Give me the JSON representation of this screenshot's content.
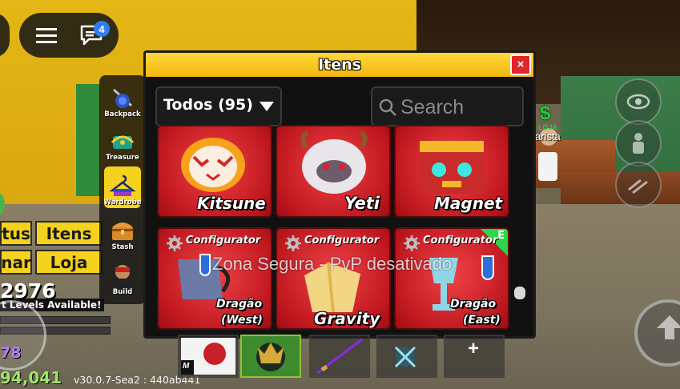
{
  "topbar": {
    "menu_icon": "hamburger-menu-icon",
    "chat_icon": "chat-bubble-icon",
    "chat_badge": "4"
  },
  "left_menu": {
    "row1": [
      "tus",
      "Itens"
    ],
    "row2": [
      "nar",
      "Loja"
    ]
  },
  "stats": {
    "beli_value": "2976",
    "levels_text": "t Levels Available!",
    "purple_value": "78",
    "green_value": "94,041"
  },
  "version": "v30.0.7-Sea2 : 440ab441",
  "npc": {
    "dollar": "$",
    "sign": "LOJA",
    "name": "arista"
  },
  "sidebar": {
    "items": [
      {
        "label": "Backpack",
        "icon": "backpack-icon",
        "active": false
      },
      {
        "label": "Treasure",
        "icon": "treasure-icon",
        "active": false
      },
      {
        "label": "Wardrobe",
        "icon": "wardrobe-hanger-icon",
        "active": true
      },
      {
        "label": "Stash",
        "icon": "stash-chest-icon",
        "active": false
      },
      {
        "label": "Build",
        "icon": "build-character-icon",
        "active": false
      }
    ]
  },
  "window": {
    "title": "Itens",
    "close_label": "×",
    "filter_label": "Todos (95)",
    "search_placeholder": "Search"
  },
  "items": [
    {
      "name": "Kitsune",
      "configurator": "Configurator"
    },
    {
      "name": "Yeti",
      "configurator": "Configurator"
    },
    {
      "name": "Magnet",
      "configurator": "Configurator"
    },
    {
      "name_line1": "Dragão",
      "name_line2": "(West)",
      "configurator": "Configurator"
    },
    {
      "name": "Gravity",
      "configurator": "Configurator"
    },
    {
      "name_line1": "Dragão",
      "name_line2": "(East)",
      "configurator": "Configurator",
      "badge": "E"
    }
  ],
  "safe_zone_text": "Zona Segura - PvP desativado",
  "hotbar": {
    "slot1_tag": "M",
    "plus": "+"
  },
  "colors": {
    "accent_yellow": "#f4d21e",
    "card_red": "#d12128",
    "badge_green": "#2fd64c",
    "close_red": "#e0262a"
  }
}
